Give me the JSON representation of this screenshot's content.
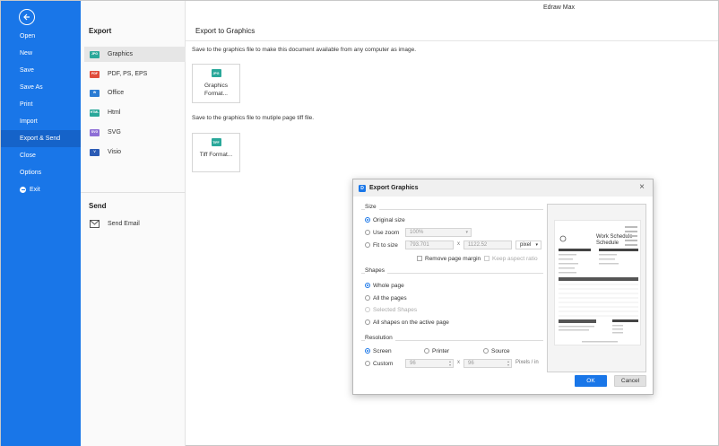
{
  "app": {
    "title": "Edraw Max"
  },
  "sidebar": {
    "items": [
      {
        "label": "Open"
      },
      {
        "label": "New"
      },
      {
        "label": "Save"
      },
      {
        "label": "Save As"
      },
      {
        "label": "Print"
      },
      {
        "label": "Import"
      },
      {
        "label": "Export & Send",
        "active": true
      },
      {
        "label": "Close"
      },
      {
        "label": "Options"
      },
      {
        "label": "Exit"
      }
    ],
    "accent_color": "#1976e8"
  },
  "export_panel": {
    "heading": "Export",
    "items": [
      {
        "label": "Graphics",
        "icon": "JPG",
        "color": "#2aa89a",
        "active": true
      },
      {
        "label": "PDF, PS, EPS",
        "icon": "PDF",
        "color": "#e04c3c"
      },
      {
        "label": "Office",
        "icon": "W",
        "color": "#2b7cd3"
      },
      {
        "label": "Html",
        "icon": "HTML",
        "color": "#2aa89a"
      },
      {
        "label": "SVG",
        "icon": "SVG",
        "color": "#8e6fd6"
      },
      {
        "label": "Visio",
        "icon": "V",
        "color": "#2b5bb5"
      }
    ],
    "send_heading": "Send",
    "send_item": {
      "label": "Send Email",
      "icon": "email-icon"
    }
  },
  "content": {
    "title": "Export to Graphics",
    "desc1": "Save to the graphics file to make this document available from any computer as image.",
    "card1": {
      "icon": "JPG",
      "label": "Graphics Format..."
    },
    "desc2": "Save to the graphics file to mutiple page tiff file.",
    "card2": {
      "icon": "TIFF",
      "label": "Tiff Format..."
    }
  },
  "dialog": {
    "title": "Export Graphics",
    "size": {
      "label": "Size",
      "original": "Original size",
      "use_zoom": "Use zoom",
      "zoom_value": "100%",
      "fit_to_size": "Fit to size",
      "width": "793.701",
      "x_sep": "x",
      "height": "1122.52",
      "unit": "pixel",
      "remove_margin": "Remove page margin",
      "keep_aspect": "Keep aspect ratio"
    },
    "shapes": {
      "label": "Shapes",
      "whole_page": "Whole page",
      "all_pages": "All the pages",
      "selected": "Selected Shapes",
      "all_on_active": "All shapes on the active page"
    },
    "resolution": {
      "label": "Resolution",
      "screen": "Screen",
      "printer": "Printer",
      "source": "Source",
      "custom": "Custom",
      "dpi_x": "96",
      "x_sep": "x",
      "dpi_y": "96",
      "unit": "Pixels / in"
    },
    "preview": {
      "title": "Work Schedule"
    },
    "ok_label": "OK",
    "cancel_label": "Cancel"
  }
}
